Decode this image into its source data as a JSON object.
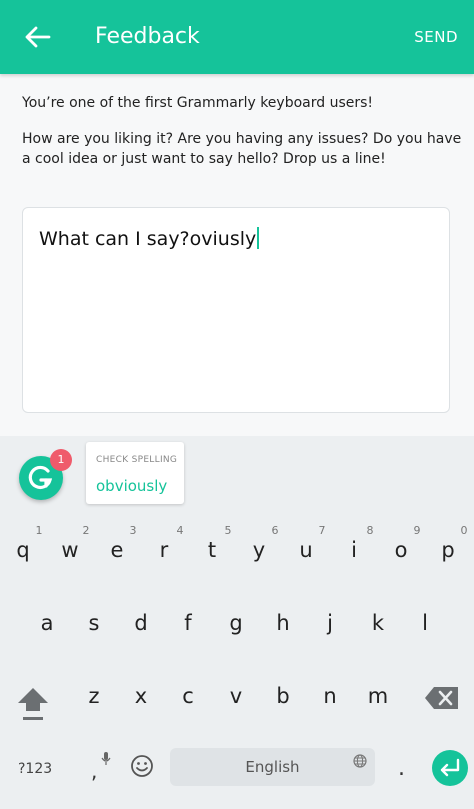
{
  "header": {
    "title": "Feedback",
    "send_label": "SEND",
    "bar_color": "#15c39a"
  },
  "intro": {
    "line1": "You’re one of the first Grammarly keyboard users!",
    "line2": "How are you liking it? Are you having any issues? Do you have a cool idea or just want to say hello? Drop us a line!"
  },
  "feedback_input": {
    "value": "What can I say?oviusly"
  },
  "grammarly": {
    "badge_count": "1",
    "suggestion_label": "CHECK SPELLING",
    "suggestion_word": "obviously",
    "accent": "#15c39a",
    "badge_color": "#ef5b6b"
  },
  "keyboard": {
    "row1": [
      "q",
      "w",
      "e",
      "r",
      "t",
      "y",
      "u",
      "i",
      "o",
      "p"
    ],
    "row1_hints": [
      "1",
      "2",
      "3",
      "4",
      "5",
      "6",
      "7",
      "8",
      "9",
      "0"
    ],
    "row2": [
      "a",
      "s",
      "d",
      "f",
      "g",
      "h",
      "j",
      "k",
      "l"
    ],
    "row3": [
      "z",
      "x",
      "c",
      "v",
      "b",
      "n",
      "m"
    ],
    "symbols_label": "?123",
    "comma": ",",
    "space_label": "English",
    "period": ".",
    "icons": [
      "shift-icon",
      "backspace-icon",
      "mic-icon",
      "emoji-icon",
      "globe-icon",
      "enter-icon"
    ]
  }
}
